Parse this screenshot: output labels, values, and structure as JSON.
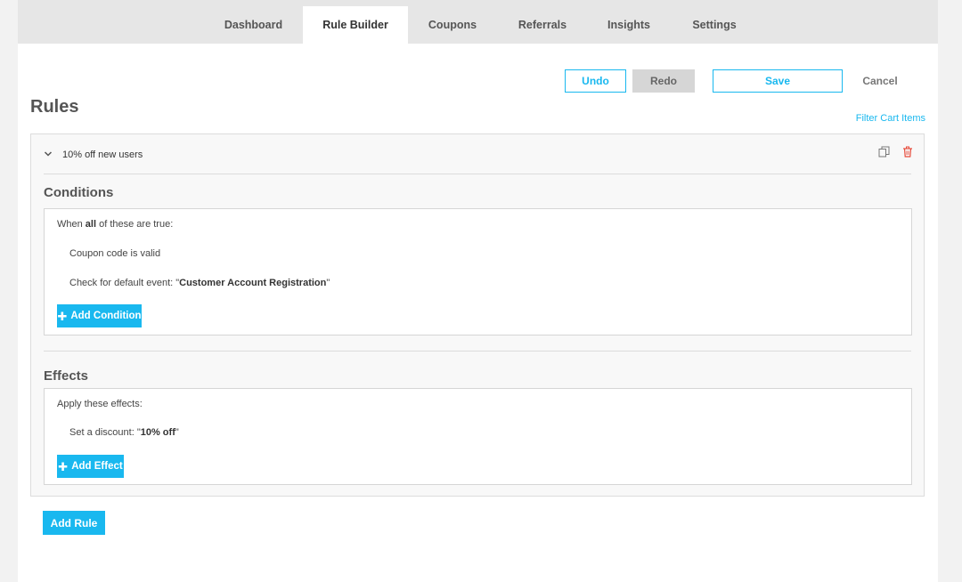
{
  "nav": {
    "tabs": [
      {
        "label": "Dashboard",
        "active": false
      },
      {
        "label": "Rule Builder",
        "active": true
      },
      {
        "label": "Coupons",
        "active": false
      },
      {
        "label": "Referrals",
        "active": false
      },
      {
        "label": "Insights",
        "active": false
      },
      {
        "label": "Settings",
        "active": false
      }
    ]
  },
  "toolbar": {
    "undo_label": "Undo",
    "redo_label": "Redo",
    "save_label": "Save",
    "cancel_label": "Cancel"
  },
  "page": {
    "title": "Rules",
    "filter_link": "Filter Cart Items",
    "add_rule_label": "Add Rule"
  },
  "rule": {
    "name": "10% off new users",
    "conditions": {
      "title": "Conditions",
      "intro_prefix": "When ",
      "intro_bold": "all",
      "intro_suffix": " of these are true:",
      "items": [
        {
          "prefix": "Coupon code is valid",
          "bold": "",
          "suffix": ""
        },
        {
          "prefix": "Check for default event: \"",
          "bold": "Customer Account Registration",
          "suffix": "\""
        }
      ],
      "add_label": "Add Condition"
    },
    "effects": {
      "title": "Effects",
      "intro": "Apply these effects:",
      "items": [
        {
          "prefix": "Set a discount: \"",
          "bold": "10% off",
          "suffix": "\""
        }
      ],
      "add_label": "Add Effect"
    }
  },
  "colors": {
    "accent": "#19b8ef",
    "delete": "#e74c3c"
  },
  "icons": {
    "expand": "chevron-down-icon",
    "duplicate": "copy-icon",
    "delete": "trash-icon",
    "add": "plus-icon"
  }
}
